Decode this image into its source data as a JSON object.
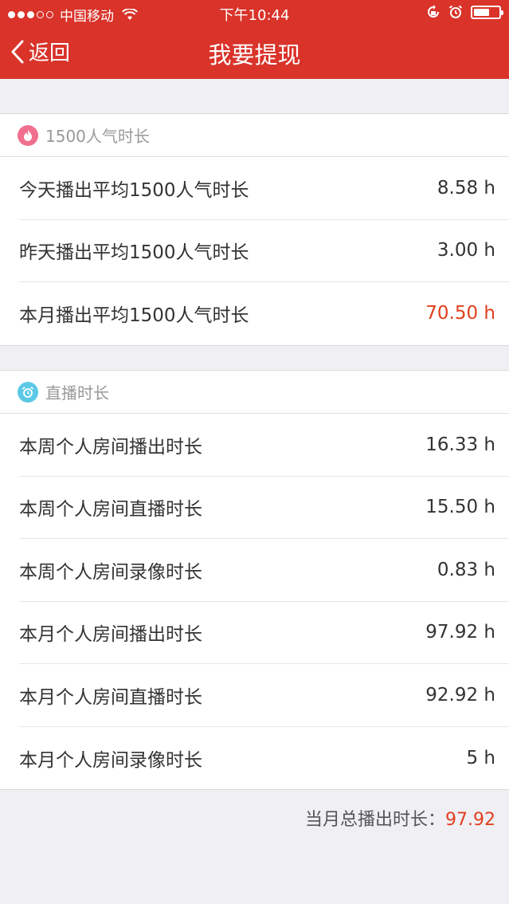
{
  "status_bar": {
    "carrier": "中国移动",
    "time": "下午10:44"
  },
  "nav": {
    "back_label": "返回",
    "title": "我要提现"
  },
  "sections": [
    {
      "title": "1500人气时长",
      "icon": "flame-icon",
      "icon_color": "#f06f8e",
      "rows": [
        {
          "label": "今天播出平均1500人气时长",
          "value": "8.58 h"
        },
        {
          "label": "昨天播出平均1500人气时长",
          "value": "3.00 h"
        },
        {
          "label": "本月播出平均1500人气时长",
          "value": "70.50 h"
        }
      ]
    },
    {
      "title": "直播时长",
      "icon": "alarm-clock-icon",
      "icon_color": "#5bc9e6",
      "rows": [
        {
          "label": "本周个人房间播出时长",
          "value": "16.33 h"
        },
        {
          "label": "本周个人房间直播时长",
          "value": "15.50 h"
        },
        {
          "label": "本周个人房间录像时长",
          "value": "0.83 h"
        },
        {
          "label": "本月个人房间播出时长",
          "value": "97.92 h"
        },
        {
          "label": "本月个人房间直播时长",
          "value": "92.92 h"
        },
        {
          "label": "本月个人房间录像时长",
          "value": "5 h"
        }
      ]
    }
  ],
  "footer": {
    "total_label": "当月总播出时长：",
    "total_value": "97.92"
  },
  "colors": {
    "header": "#d9332a",
    "highlight": "#e0401f"
  }
}
